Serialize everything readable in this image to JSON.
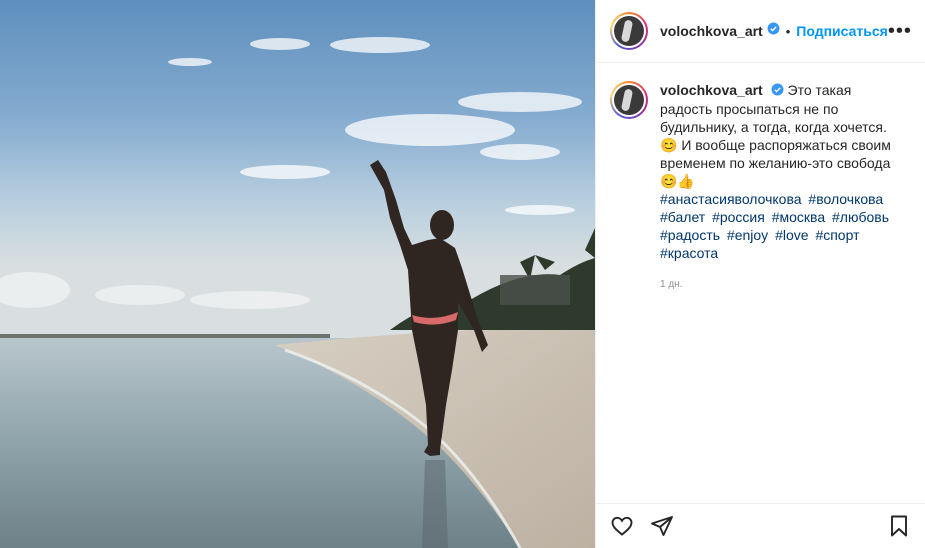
{
  "post": {
    "username": "volochkova_art",
    "follow_label": "Подписаться",
    "separator": "•",
    "more_label": "•••",
    "caption_text": "Это такая радость просыпаться не по будильнику, а тогда, когда хочется.😊 И вообще распоряжаться своим временем по желанию-это свобода😊👍",
    "hashtags": [
      "#анастасияволочкова",
      "#волочкова",
      "#балет",
      "#россия",
      "#москва",
      "#любовь",
      "#радость",
      "#enjoy",
      "#love",
      "#спорт",
      "#красота"
    ],
    "time": "1 дн."
  },
  "icons": {
    "verified": "verified-badge-icon",
    "like": "heart-icon",
    "share": "paper-plane-icon",
    "save": "bookmark-icon"
  },
  "colors": {
    "accent": "#0095f6",
    "hashtag": "#00376b",
    "muted": "#8e8e8e",
    "verified": "#3897f0"
  }
}
